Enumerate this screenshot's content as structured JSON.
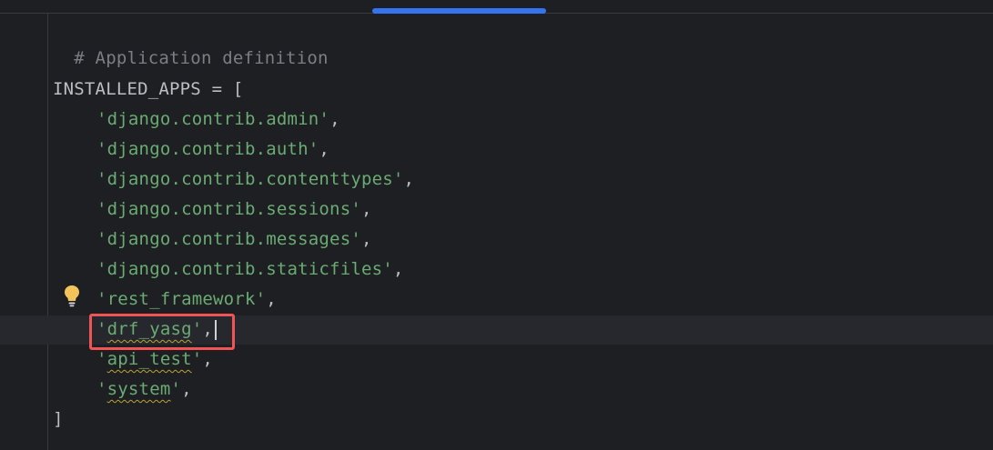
{
  "editor": {
    "lines": [
      {
        "text": "# Application definition"
      },
      {
        "text": ""
      },
      {
        "name": "INSTALLED_APPS",
        "op": " = ",
        "open": "["
      },
      {
        "str": "'django.contrib.admin'",
        "tail": ","
      },
      {
        "str": "'django.contrib.auth'",
        "tail": ","
      },
      {
        "str": "'django.contrib.contenttypes'",
        "tail": ","
      },
      {
        "str": "'django.contrib.sessions'",
        "tail": ","
      },
      {
        "str": "'django.contrib.messages'",
        "tail": ","
      },
      {
        "str": "'django.contrib.staticfiles'",
        "tail": ","
      },
      {
        "str": "'rest_framework'",
        "tail": ","
      },
      {
        "q1": "'",
        "word": "drf_yasg",
        "q2": "'",
        "tail": ","
      },
      {
        "q1": "'",
        "word": "api_test",
        "q2": "'",
        "tail": ","
      },
      {
        "q1": "'",
        "word": "system",
        "q2": "'",
        "tail": ","
      },
      {
        "text": "]"
      }
    ]
  },
  "colors": {
    "background": "#1e1f22",
    "comment": "#7a7e85",
    "string": "#6aab73",
    "text": "#bcbec4",
    "accent": "#3574f0",
    "annotation_box": "#f05454",
    "intention_bulb": "#f2c55c"
  },
  "icons": {
    "gutter_icon": "lightbulb-icon"
  }
}
